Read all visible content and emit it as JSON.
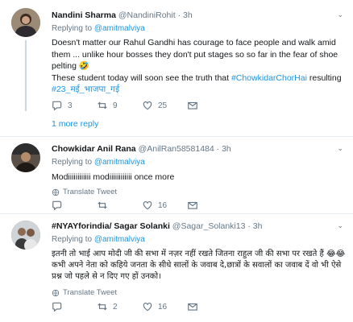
{
  "tweets": [
    {
      "name": "Nandini Sharma",
      "handle": "@NandiniRohit",
      "dot": "·",
      "time": "3h",
      "replying_prefix": "Replying to ",
      "replying_to": "@amitmalviya",
      "text1": "Doesn't matter our Rahul Gandhi has courage to face people and walk amid them ... unlike hour bosses they don't put stages so so far in the fear of shoe pelting",
      "emoji1": "🤣",
      "text2": "These student today will soon see the truth that ",
      "hashtag1": "#ChowkidarChorHai",
      "text3": " resulting",
      "hashtag2": "#23_मई_भाजपा_गई",
      "replies": "3",
      "retweets": "9",
      "likes": "25",
      "more_replies": "1 more reply"
    },
    {
      "name": "Chowkidar Anil Rana",
      "handle": "@AnilRan58581484",
      "dot": "·",
      "time": "3h",
      "replying_prefix": "Replying to ",
      "replying_to": "@amitmalviya",
      "text1": "Modiiiiiiiiiiii modiiiiiiiiiiii once more",
      "translate": "Translate Tweet",
      "replies": "",
      "retweets": "",
      "likes": "16"
    },
    {
      "name": "#NYAYforindia/ Sagar Solanki",
      "handle": "@Sagar_Solanki13",
      "dot": "·",
      "time": "3h",
      "replying_prefix": "Replying to ",
      "replying_to": "@amitmalviya",
      "text1": "इतनी तो भाई आप मोदी जी की सभा में नज़र नहीं रखते जितना राहुल जी की सभा पर रखते हैं",
      "emoji1": "😂😂",
      "text2": " कभी अपने नेता को कहिये जनता के सीधे सालों के जवाब दे,छात्रों के सवालों का जवाब दें वो भी ऐसे प्रश्न जो पहले से न दिए गए हों उनको।",
      "translate": "Translate Tweet",
      "replies": "",
      "retweets": "2",
      "likes": "16"
    }
  ],
  "icons": {
    "reply": "reply-icon",
    "retweet": "retweet-icon",
    "like": "heart-icon",
    "message": "envelope-icon",
    "more": "chevron-down-icon",
    "globe": "globe-icon"
  },
  "colors": {
    "link": "#1b95e0",
    "muted": "#657786",
    "text": "#14171a",
    "divider": "#e6ecf0"
  }
}
